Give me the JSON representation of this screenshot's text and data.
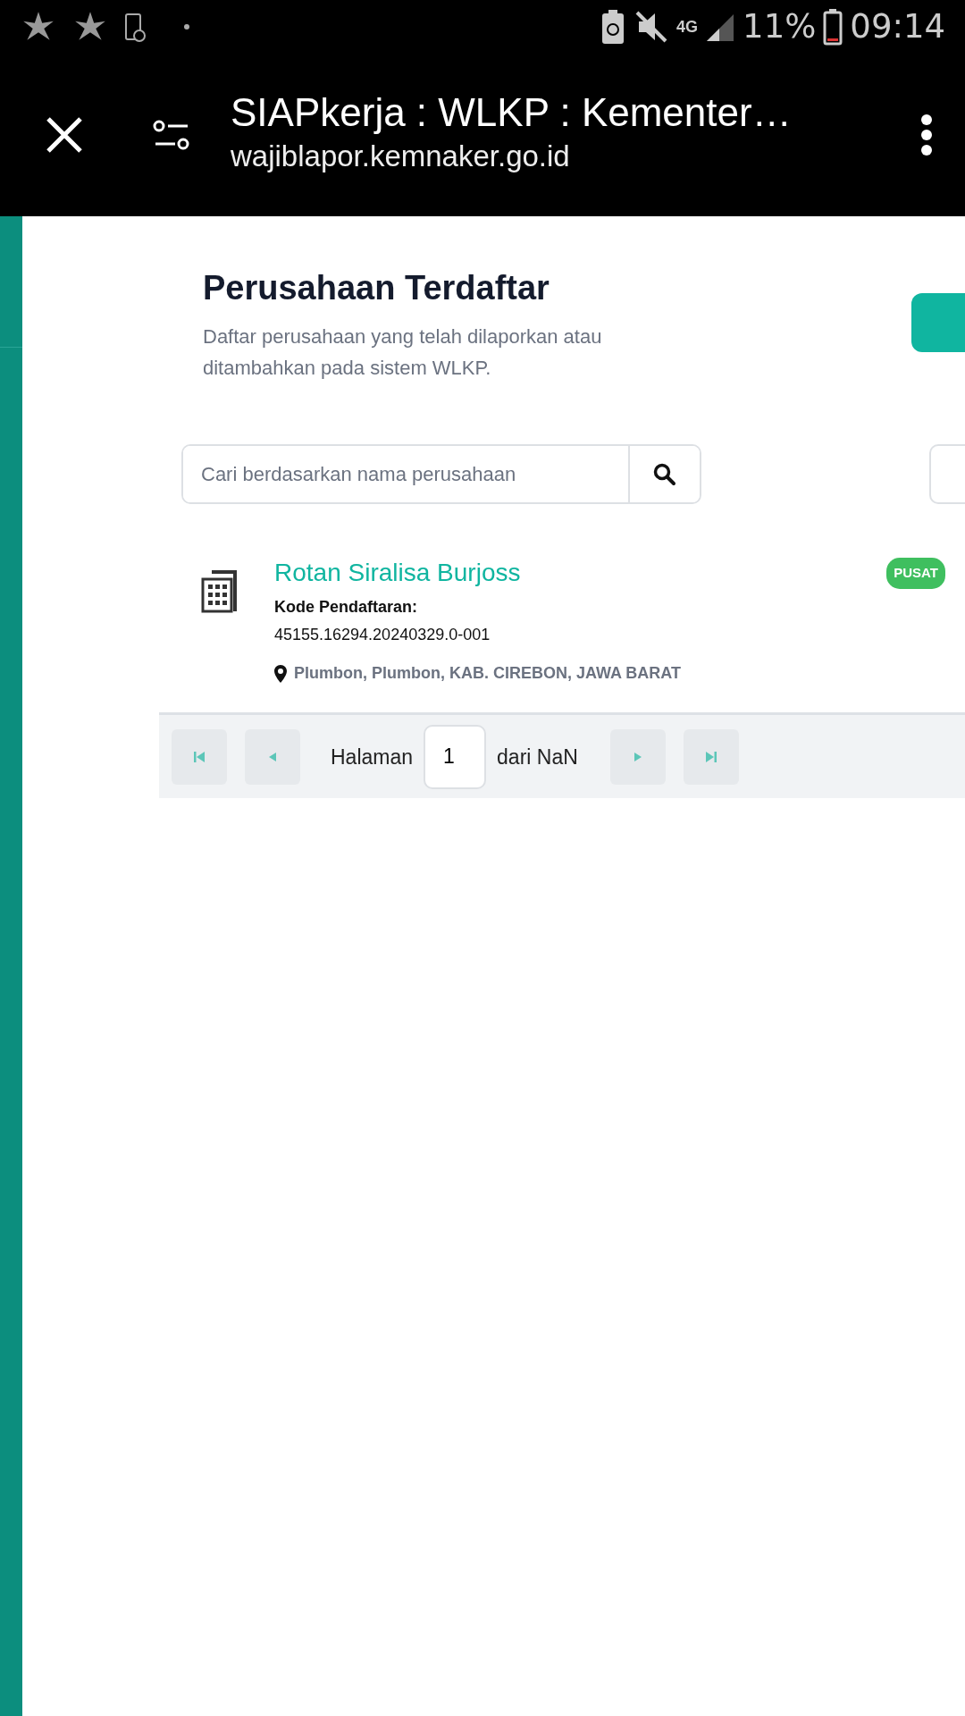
{
  "status_bar": {
    "network": "4G",
    "battery": "11%",
    "time": "09:14"
  },
  "browser_bar": {
    "title": "SIAPkerja : WLKP : Kementer…",
    "url": "wajiblapor.kemnaker.go.id"
  },
  "page": {
    "title": "Perusahaan Terdaftar",
    "subtitle": "Daftar perusahaan yang telah dilaporkan atau ditambahkan pada sistem WLKP.",
    "search": {
      "placeholder": "Cari berdasarkan nama perusahaan"
    }
  },
  "companies": [
    {
      "name": "Rotan Siralisa Burjoss",
      "badge": "PUSAT",
      "code_label": "Kode Pendaftaran:",
      "code": "45155.16294.20240329.0-001",
      "location": "Plumbon, Plumbon, KAB. CIREBON, JAWA BARAT"
    }
  ],
  "pagination": {
    "label": "Halaman",
    "page": "1",
    "total": "dari NaN"
  }
}
